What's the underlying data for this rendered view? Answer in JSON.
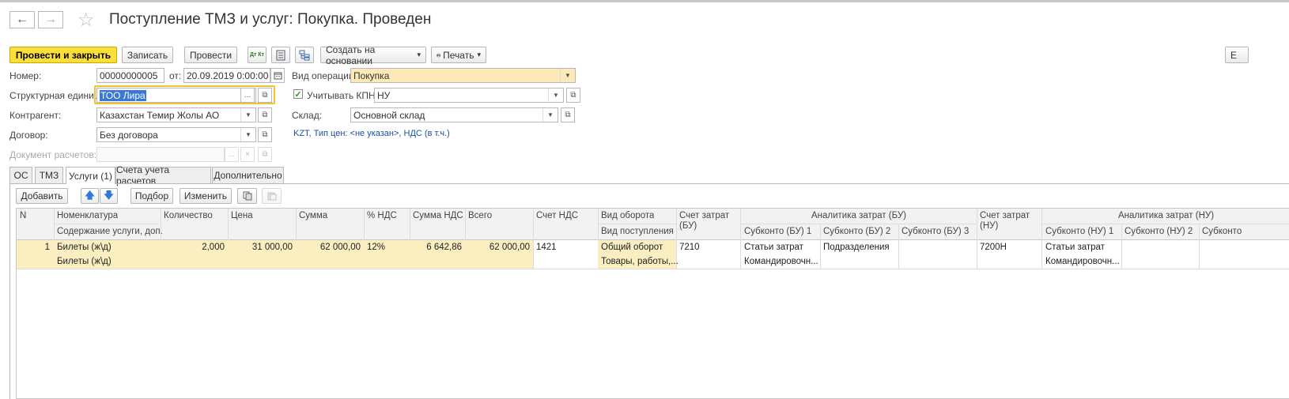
{
  "window": {
    "title": "Поступление ТМЗ и услуг: Покупка. Проведен",
    "back_label": "←",
    "forward_label": "→",
    "star_label": "☆",
    "right_edge_button": "Е"
  },
  "toolbar": {
    "post_close": "Провести и закрыть",
    "save": "Записать",
    "post": "Провести",
    "dt_kt_label": "Дт Кт",
    "create_based": "Создать на основании",
    "print": "Печать",
    "dropdown_arrow": "▾"
  },
  "form": {
    "number_label": "Номер:",
    "number_value": "00000000005",
    "date_label": "от:",
    "date_value": "20.09.2019  0:00:00",
    "operation_label": "Вид операции:",
    "operation_value": "Покупка",
    "unit_label": "Структурная единица:",
    "unit_value": "ТОО  Лира",
    "kpn_label": "Учитывать КПН",
    "kpn_checked": true,
    "kpn_value": "НУ",
    "counterparty_label": "Контрагент:",
    "counterparty_value": "Казахстан Темир Жолы АО",
    "warehouse_label": "Склад:",
    "warehouse_value": "Основной склад",
    "contract_label": "Договор:",
    "contract_value": "Без договора",
    "price_link": "KZT, Тип цен: <не указан>, НДС (в т.ч.)",
    "settlement_label": "Документ расчетов:",
    "settlement_value": "",
    "dots": "...",
    "clear": "×",
    "open": "⧉"
  },
  "tabs": [
    {
      "label": "ОС",
      "active": false
    },
    {
      "label": "ТМЗ",
      "active": false
    },
    {
      "label": "Услуги (1)",
      "active": true
    },
    {
      "label": "Счета учета расчетов",
      "active": false
    },
    {
      "label": "Дополнительно",
      "active": false
    }
  ],
  "table_toolbar": {
    "add": "Добавить",
    "up": "🡅",
    "down": "🡇",
    "pick": "Подбор",
    "change": "Изменить"
  },
  "table": {
    "headers": {
      "n": "N",
      "item": "Номенклатура",
      "item_sub": "Содержание услуги, доп.",
      "qty": "Количество",
      "price": "Цена",
      "sum": "Сумма",
      "vat_pct": "% НДС",
      "vat_sum": "Сумма НДС",
      "total": "Всего",
      "vat_account": "Счет НДС",
      "turnover": "Вид оборота",
      "receipt": "Вид поступления",
      "cost_account_bu": "Счет затрат (БУ)",
      "analytics_bu": "Аналитика затрат (БУ)",
      "sub_bu1": "Субконто (БУ) 1",
      "sub_bu2": "Субконто (БУ) 2",
      "sub_bu3": "Субконто (БУ) 3",
      "cost_account_nu": "Счет затрат (НУ)",
      "analytics_nu": "Аналитика затрат (НУ)",
      "sub_nu1": "Субконто (НУ) 1",
      "sub_nu2": "Субконто (НУ) 2",
      "sub_nu3": "Субконто"
    },
    "rows": [
      {
        "n": "1",
        "item": "Билеты (ж\\д)",
        "item_sub": "Билеты (ж\\д)",
        "qty": "2,000",
        "price": "31 000,00",
        "sum": "62 000,00",
        "vat_pct": "12%",
        "vat_sum": "6 642,86",
        "total": "62 000,00",
        "vat_account": "1421",
        "turnover": "Общий оборот",
        "receipt": "Товары, работы,...",
        "cost_account_bu": "7210",
        "sub_bu1": "Статьи затрат",
        "sub_bu1_b": "Командировочн...",
        "sub_bu2": "Подразделения",
        "cost_account_nu": "7200Н",
        "sub_nu1": "Статьи затрат",
        "sub_nu1_b": "Командировочн..."
      }
    ]
  }
}
